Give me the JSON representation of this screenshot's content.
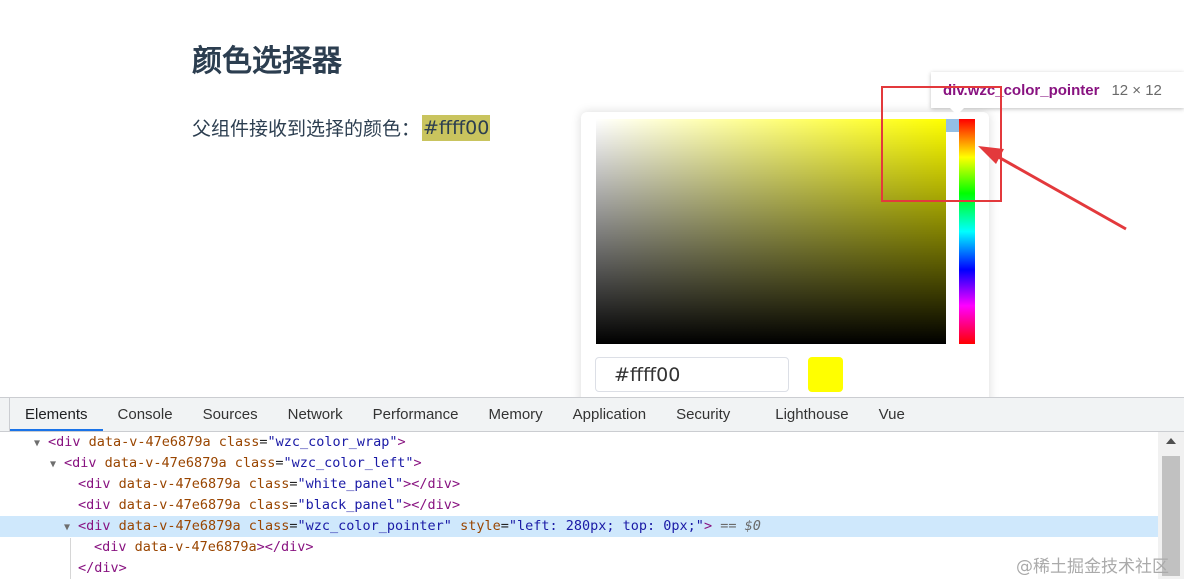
{
  "page": {
    "title": "颜色选择器",
    "result_label": "父组件接收到选择的颜色：",
    "result_value": "#ffff00"
  },
  "picker": {
    "hex_value": "#ffff00",
    "selected_color": "#ffff00"
  },
  "tooltip": {
    "selector": "div.wzc_color_pointer",
    "dimensions": "12 × 12"
  },
  "devtools": {
    "tabs": [
      "Elements",
      "Console",
      "Sources",
      "Network",
      "Performance",
      "Memory",
      "Application",
      "Security",
      "Lighthouse",
      "Vue"
    ],
    "active_tab": "Elements",
    "lines": [
      {
        "text_tag_open": "<div",
        "attr1": "data-v-47e6879a",
        "attr2": "class",
        "val2": "\"wzc_color_wrap\"",
        "close": ">"
      },
      {
        "text_tag_open": "<div",
        "attr1": "data-v-47e6879a",
        "attr2": "class",
        "val2": "\"wzc_color_left\"",
        "close": ">"
      },
      {
        "text_tag_open": "<div",
        "attr1": "data-v-47e6879a",
        "attr2": "class",
        "val2": "\"white_panel\"",
        "close": "></div>"
      },
      {
        "text_tag_open": "<div",
        "attr1": "data-v-47e6879a",
        "attr2": "class",
        "val2": "\"black_panel\"",
        "close": "></div>"
      },
      {
        "text_tag_open": "<div",
        "attr1": "data-v-47e6879a",
        "attr2": "class",
        "val2": "\"wzc_color_pointer\"",
        "attr3": "style",
        "val3": "\"left: 280px; top: 0px;\"",
        "close": ">",
        "eq_marker": "== $0"
      },
      {
        "text_tag_open": "<div",
        "attr1": "data-v-47e6879a",
        "close": "></div>"
      },
      {
        "text_tag_open": "</div>"
      }
    ]
  },
  "watermark": "@稀土掘金技术社区",
  "colors": {
    "highlight": "#c9c45e",
    "annotation_red": "#e3393c",
    "selection_bg": "#cfe8fc",
    "active_tab_underline": "#1a73e8"
  }
}
